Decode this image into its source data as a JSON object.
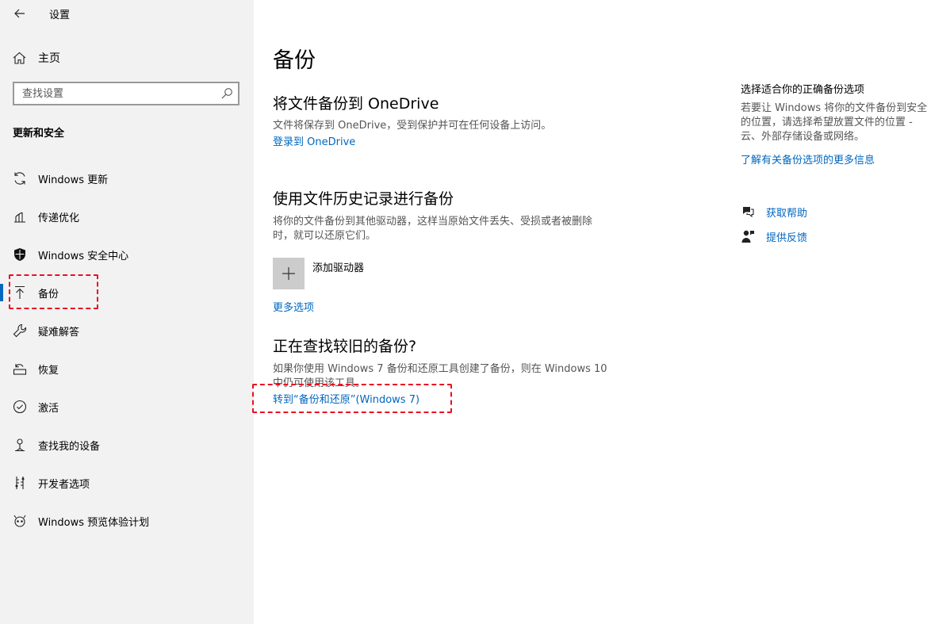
{
  "app": {
    "title": "设置"
  },
  "sidebar": {
    "home_label": "主页",
    "search_placeholder": "查找设置",
    "section_heading": "更新和安全",
    "items": [
      {
        "label": "Windows 更新",
        "icon": "sync-icon"
      },
      {
        "label": "传递优化",
        "icon": "delivery-optimization-icon"
      },
      {
        "label": "Windows 安全中心",
        "icon": "shield-icon"
      },
      {
        "label": "备份",
        "icon": "backup-arrow-icon",
        "active": true
      },
      {
        "label": "疑难解答",
        "icon": "wrench-icon"
      },
      {
        "label": "恢复",
        "icon": "recovery-icon"
      },
      {
        "label": "激活",
        "icon": "check-circle-icon"
      },
      {
        "label": "查找我的设备",
        "icon": "find-device-icon"
      },
      {
        "label": "开发者选项",
        "icon": "developer-icon"
      },
      {
        "label": "Windows 预览体验计划",
        "icon": "insider-icon"
      }
    ]
  },
  "main": {
    "page_title": "备份",
    "onedrive": {
      "heading": "将文件备份到 OneDrive",
      "description": "文件将保存到 OneDrive，受到保护并可在任何设备上访问。",
      "link": "登录到 OneDrive"
    },
    "file_history": {
      "heading": "使用文件历史记录进行备份",
      "description_line1": "将你的文件备份到其他驱动器，这样当原始文件丢失、受损或者被删除",
      "description_line2": "时，就可以还原它们。",
      "add_drive_label": "添加驱动器",
      "more_options_link": "更多选项"
    },
    "older_backup": {
      "heading": "正在查找较旧的备份?",
      "description_line1": "如果你使用 Windows 7 备份和还原工具创建了备份，则在 Windows 10",
      "description_line2": "中仍可使用该工具。",
      "link": "转到“备份和还原”(Windows 7)"
    }
  },
  "right_column": {
    "title": "选择适合你的正确备份选项",
    "description": "若要让 Windows 将你的文件备份到安全的位置，请选择希望放置文件的位置 - 云、外部存储设备或网络。",
    "learn_more_link": "了解有关备份选项的更多信息",
    "get_help": "获取帮助",
    "feedback": "提供反馈"
  },
  "colors": {
    "accent": "#0067c0",
    "sidebar_bg": "#f2f2f2",
    "highlight_dash": "#e81123"
  }
}
